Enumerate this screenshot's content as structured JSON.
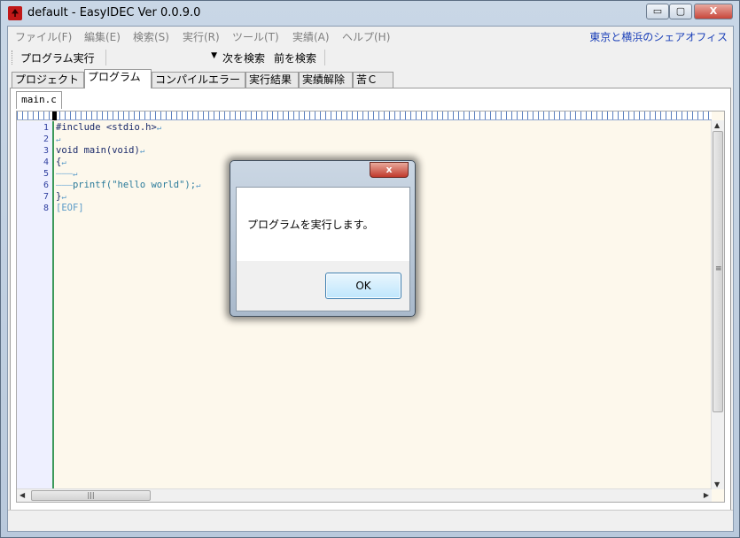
{
  "window": {
    "title": "default - EasyIDEC Ver 0.0.9.0",
    "controls": {
      "minimize": "▭",
      "maximize": "▢",
      "close": "X"
    }
  },
  "menubar": {
    "items": [
      "ファイル(F)",
      "編集(E)",
      "検索(S)",
      "実行(R)",
      "ツール(T)",
      "実績(A)",
      "ヘルプ(H)"
    ],
    "right_link": "東京と横浜のシェアオフィス"
  },
  "toolbar": {
    "run_label": "プログラム実行",
    "search_value": "",
    "next_label": "次を検索",
    "prev_label": "前を検索"
  },
  "tabs": [
    {
      "label": "プロジェクト",
      "active": false
    },
    {
      "label": "プログラム",
      "active": true
    },
    {
      "label": "コンパイルエラー",
      "active": false
    },
    {
      "label": "実行結果",
      "active": false
    },
    {
      "label": "実績解除",
      "active": false
    },
    {
      "label": "苦Ｃ",
      "active": false
    }
  ],
  "editor": {
    "file_tab": "main.c",
    "line_numbers": [
      "1",
      "2",
      "3",
      "4",
      "5",
      "6",
      "7",
      "8"
    ],
    "lines": [
      "#include <stdio.h>",
      "",
      "void main(void)",
      "{",
      "",
      "printf(\"hello world\");",
      "}",
      "[EOF]"
    ],
    "eol_mark": "↵",
    "hscroll_grip": "|||",
    "vscroll_grip": "≡"
  },
  "dialog": {
    "message": "プログラムを実行します。",
    "ok_label": "OK",
    "close_label": "x"
  }
}
